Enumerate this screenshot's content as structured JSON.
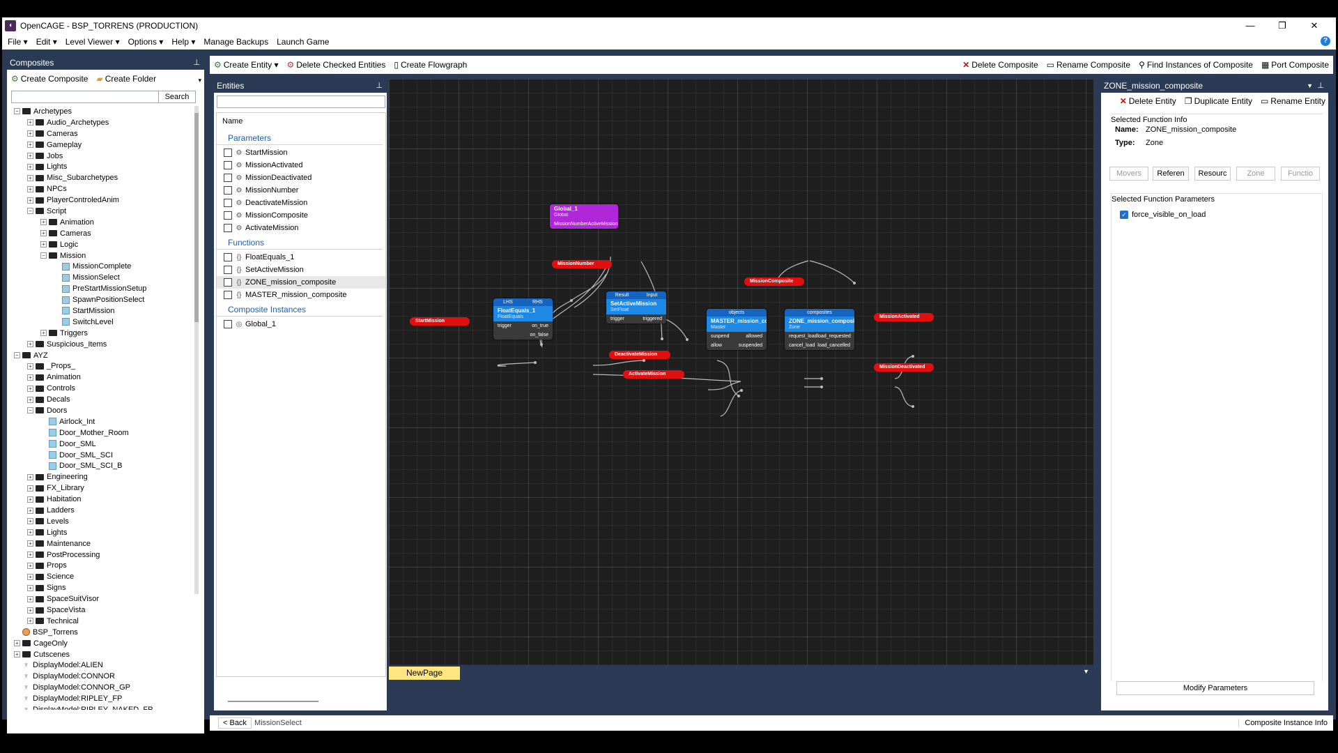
{
  "window": {
    "title": "OpenCAGE - BSP_TORRENS (PRODUCTION)",
    "app_icon": "opencage-icon",
    "controls": [
      "—",
      "❐",
      "✕"
    ]
  },
  "menu": {
    "items": [
      "File ▾",
      "Edit ▾",
      "Level Viewer ▾",
      "Options ▾",
      "Help ▾",
      "Manage Backups",
      "Launch Game"
    ],
    "help": "?"
  },
  "composites": {
    "title": "Composites",
    "create_composite": "Create Composite",
    "create_folder": "Create Folder",
    "search_value": "",
    "search_button": "Search",
    "tree": [
      {
        "depth": 0,
        "exp": "−",
        "icon": "folder",
        "label": "Archetypes"
      },
      {
        "depth": 1,
        "exp": "+",
        "icon": "folder",
        "label": "Audio_Archetypes"
      },
      {
        "depth": 1,
        "exp": "+",
        "icon": "folder",
        "label": "Cameras"
      },
      {
        "depth": 1,
        "exp": "+",
        "icon": "folder",
        "label": "Gameplay"
      },
      {
        "depth": 1,
        "exp": "+",
        "icon": "folder",
        "label": "Jobs"
      },
      {
        "depth": 1,
        "exp": "+",
        "icon": "folder",
        "label": "Lights"
      },
      {
        "depth": 1,
        "exp": "+",
        "icon": "folder",
        "label": "Misc_Subarchetypes"
      },
      {
        "depth": 1,
        "exp": "+",
        "icon": "folder",
        "label": "NPCs"
      },
      {
        "depth": 1,
        "exp": "+",
        "icon": "folder",
        "label": "PlayerControledAnim"
      },
      {
        "depth": 1,
        "exp": "−",
        "icon": "folder",
        "label": "Script"
      },
      {
        "depth": 2,
        "exp": "+",
        "icon": "folder",
        "label": "Animation"
      },
      {
        "depth": 2,
        "exp": "+",
        "icon": "folder",
        "label": "Cameras"
      },
      {
        "depth": 2,
        "exp": "+",
        "icon": "folder",
        "label": "Logic"
      },
      {
        "depth": 2,
        "exp": "−",
        "icon": "folder",
        "label": "Mission"
      },
      {
        "depth": 3,
        "exp": "",
        "icon": "cube",
        "label": "MissionComplete"
      },
      {
        "depth": 3,
        "exp": "",
        "icon": "cube",
        "label": "MissionSelect"
      },
      {
        "depth": 3,
        "exp": "",
        "icon": "cube",
        "label": "PreStartMissionSetup"
      },
      {
        "depth": 3,
        "exp": "",
        "icon": "cube",
        "label": "SpawnPositionSelect"
      },
      {
        "depth": 3,
        "exp": "",
        "icon": "cube",
        "label": "StartMission"
      },
      {
        "depth": 3,
        "exp": "",
        "icon": "cube",
        "label": "SwitchLevel"
      },
      {
        "depth": 2,
        "exp": "+",
        "icon": "folder",
        "label": "Triggers"
      },
      {
        "depth": 1,
        "exp": "+",
        "icon": "folder",
        "label": "Suspicious_Items"
      },
      {
        "depth": 0,
        "exp": "−",
        "icon": "folder",
        "label": "AYZ"
      },
      {
        "depth": 1,
        "exp": "+",
        "icon": "folder",
        "label": "_Props_"
      },
      {
        "depth": 1,
        "exp": "+",
        "icon": "folder",
        "label": "Animation"
      },
      {
        "depth": 1,
        "exp": "+",
        "icon": "folder",
        "label": "Controls"
      },
      {
        "depth": 1,
        "exp": "+",
        "icon": "folder",
        "label": "Decals"
      },
      {
        "depth": 1,
        "exp": "−",
        "icon": "folder",
        "label": "Doors"
      },
      {
        "depth": 2,
        "exp": "",
        "icon": "cube",
        "label": "Airlock_Int"
      },
      {
        "depth": 2,
        "exp": "",
        "icon": "cube",
        "label": "Door_Mother_Room"
      },
      {
        "depth": 2,
        "exp": "",
        "icon": "cube",
        "label": "Door_SML"
      },
      {
        "depth": 2,
        "exp": "",
        "icon": "cube",
        "label": "Door_SML_SCI"
      },
      {
        "depth": 2,
        "exp": "",
        "icon": "cube",
        "label": "Door_SML_SCI_B"
      },
      {
        "depth": 1,
        "exp": "+",
        "icon": "folder",
        "label": "Engineering"
      },
      {
        "depth": 1,
        "exp": "+",
        "icon": "folder",
        "label": "FX_Library"
      },
      {
        "depth": 1,
        "exp": "+",
        "icon": "folder",
        "label": "Habitation"
      },
      {
        "depth": 1,
        "exp": "+",
        "icon": "folder",
        "label": "Ladders"
      },
      {
        "depth": 1,
        "exp": "+",
        "icon": "folder",
        "label": "Levels"
      },
      {
        "depth": 1,
        "exp": "+",
        "icon": "folder",
        "label": "Lights"
      },
      {
        "depth": 1,
        "exp": "+",
        "icon": "folder",
        "label": "Maintenance"
      },
      {
        "depth": 1,
        "exp": "+",
        "icon": "folder",
        "label": "PostProcessing"
      },
      {
        "depth": 1,
        "exp": "+",
        "icon": "folder",
        "label": "Props"
      },
      {
        "depth": 1,
        "exp": "+",
        "icon": "folder",
        "label": "Science"
      },
      {
        "depth": 1,
        "exp": "+",
        "icon": "folder",
        "label": "Signs"
      },
      {
        "depth": 1,
        "exp": "+",
        "icon": "folder",
        "label": "SpaceSuitVisor"
      },
      {
        "depth": 1,
        "exp": "+",
        "icon": "folder",
        "label": "SpaceVista"
      },
      {
        "depth": 1,
        "exp": "+",
        "icon": "folder",
        "label": "Technical"
      },
      {
        "depth": 0,
        "exp": "",
        "icon": "orb",
        "label": "BSP_Torrens"
      },
      {
        "depth": 0,
        "exp": "+",
        "icon": "folder",
        "label": "CageOnly"
      },
      {
        "depth": 0,
        "exp": "+",
        "icon": "folder",
        "label": "Cutscenes"
      },
      {
        "depth": 0,
        "exp": "",
        "icon": "figure",
        "label": "DisplayModel:ALIEN"
      },
      {
        "depth": 0,
        "exp": "",
        "icon": "figure",
        "label": "DisplayModel:CONNOR"
      },
      {
        "depth": 0,
        "exp": "",
        "icon": "figure",
        "label": "DisplayModel:CONNOR_GP"
      },
      {
        "depth": 0,
        "exp": "",
        "icon": "figure",
        "label": "DisplayModel:RIPLEY_FP"
      },
      {
        "depth": 0,
        "exp": "",
        "icon": "figure",
        "label": "DisplayModel:RIPLEY_NAKED_FP"
      }
    ]
  },
  "main_toolbar": {
    "create_entity": "Create Entity ▾",
    "delete_checked": "Delete Checked Entities",
    "create_flowgraph": "Create Flowgraph",
    "delete_composite": "Delete Composite",
    "rename_composite": "Rename Composite",
    "find_instances": "Find Instances of Composite",
    "port_composite": "Port Composite"
  },
  "entities": {
    "title": "Entities",
    "search_value": "",
    "column_name": "Name",
    "sections": [
      {
        "title": "Parameters",
        "icon": "parameter-icon",
        "items": [
          "StartMission",
          "MissionActivated",
          "MissionDeactivated",
          "MissionNumber",
          "DeactivateMission",
          "MissionComposite",
          "ActivateMission"
        ]
      },
      {
        "title": "Functions",
        "icon": "function-icon",
        "items": [
          "FloatEquals_1",
          "SetActiveMission",
          "ZONE_mission_composite",
          "MASTER_mission_composite"
        ]
      },
      {
        "title": "Composite Instances",
        "icon": "composite-icon",
        "items": [
          "Global_1"
        ]
      }
    ],
    "selected_item": "ZONE_mission_composite"
  },
  "flowgraph": {
    "tab_label": "NewPage",
    "nodes": [
      {
        "id": "global",
        "title": "Global_1",
        "sub": "Global",
        "color": "#b026d9",
        "top_pins": [],
        "rows": [
          [
            "MissionNumber",
            "ActiveMissionN"
          ]
        ]
      },
      {
        "id": "floatequals",
        "title": "FloatEquals_1",
        "sub": "FloatEquals",
        "color": "#1e88e5",
        "top_pins": [
          "LHS",
          "RHS"
        ],
        "rows": [
          [
            "trigger",
            "on_true"
          ],
          [
            "",
            "on_false"
          ]
        ]
      },
      {
        "id": "setactive",
        "title": "SetActiveMission",
        "sub": "SetFloat",
        "color": "#1e88e5",
        "top_pins": [
          "Result",
          "Input"
        ],
        "rows": [
          [
            "trigger",
            "triggered"
          ]
        ]
      },
      {
        "id": "master",
        "title": "MASTER_mission_comp",
        "sub": "Master",
        "color": "#1e88e5",
        "top_pins": [
          "objects"
        ],
        "rows": [
          [
            "suspend",
            "allowed"
          ],
          [
            "allow",
            "suspended"
          ]
        ]
      },
      {
        "id": "zone",
        "title": "ZONE_mission_composite",
        "sub": "Zone",
        "color": "#1e88e5",
        "top_pins": [
          "composites"
        ],
        "rows": [
          [
            "request_load",
            "load_requested"
          ],
          [
            "cancel_load",
            "load_cancelled"
          ]
        ]
      }
    ],
    "params": [
      "StartMission",
      "MissionNumber",
      "DeactivateMission",
      "ActivateMission",
      "MissionComposite",
      "MissionActivated",
      "MissionDeactivated"
    ]
  },
  "inspector": {
    "title": "ZONE_mission_composite",
    "delete_entity": "Delete Entity",
    "duplicate_entity": "Duplicate Entity",
    "rename_entity": "Rename Entity",
    "info_group": "Selected Function Info",
    "name_label": "Name:",
    "name_value": "ZONE_mission_composite",
    "type_label": "Type:",
    "type_value": "Zone",
    "tabs": [
      "Movers",
      "Referen",
      "Resourc",
      "Zone",
      "Functio"
    ],
    "params_group": "Selected Function Parameters",
    "param_checkbox": "force_visible_on_load",
    "param_checked": true,
    "modify_button": "Modify Parameters"
  },
  "statusbar": {
    "back": "< Back",
    "path": "MissionSelect",
    "right": "Composite Instance Info"
  },
  "colors": {
    "frame": "#2b3a55",
    "canvas": "#1f1f1f",
    "node_blue": "#1e88e5",
    "node_purple": "#b026d9",
    "param_red": "#e01010",
    "tab_yellow": "#ffe680",
    "accent": "#1e5fa8"
  }
}
